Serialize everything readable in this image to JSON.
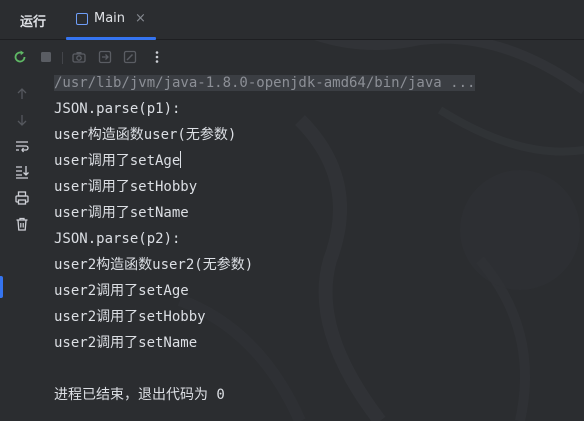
{
  "tool_window": {
    "title": "运行"
  },
  "tabs": [
    {
      "label": "Main",
      "close": "×"
    }
  ],
  "toolbar": {
    "buttons": [
      {
        "icon": "rerun-icon",
        "enabled": true
      },
      {
        "icon": "stop-icon",
        "enabled": false
      },
      {
        "icon": "camera-icon",
        "enabled": false
      },
      {
        "icon": "restore-layout-icon",
        "enabled": false
      },
      {
        "icon": "edit-config-icon",
        "enabled": false
      },
      {
        "icon": "more-options-icon",
        "enabled": true
      }
    ]
  },
  "sidebar": {
    "buttons": [
      {
        "icon": "scroll-up-icon",
        "enabled": false
      },
      {
        "icon": "scroll-down-icon",
        "enabled": false
      },
      {
        "icon": "soft-wrap-icon",
        "enabled": true
      },
      {
        "icon": "scroll-to-end-icon",
        "enabled": true
      },
      {
        "icon": "print-icon",
        "enabled": true
      },
      {
        "icon": "trash-icon",
        "enabled": true
      }
    ]
  },
  "console": {
    "command": "/usr/lib/jvm/java-1.8.0-openjdk-amd64/bin/java ...",
    "lines": [
      "JSON.parse(p1):",
      "user构造函数user(无参数)",
      "user调用了setAge",
      "user调用了setHobby",
      "user调用了setName",
      "JSON.parse(p2):",
      "user2构造函数user2(无参数)",
      "user2调用了setAge",
      "user2调用了setHobby",
      "user2调用了setName",
      "",
      "进程已结束，退出代码为 0"
    ]
  },
  "colors": {
    "background": "#2b2d30",
    "text": "#dcdfe4",
    "accent": "#3574f0",
    "rerun_green": "#5fb865"
  }
}
